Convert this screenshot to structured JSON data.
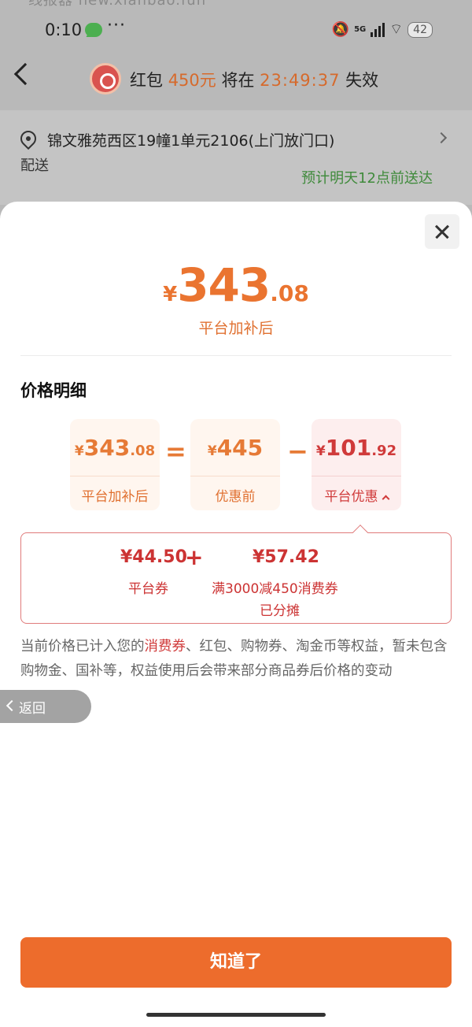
{
  "watermark": "线报器 new.xianbao.fun",
  "status_bar": {
    "time": "0:10",
    "network": "5G",
    "battery": "42",
    "more": "···"
  },
  "nav": {
    "title_prefix": "红包 ",
    "amount": "450元",
    "middle": " 将在 ",
    "countdown": "23:49:37",
    "suffix": " 失效"
  },
  "address": {
    "text": "锦文雅苑西区19幢1单元2106(上门放门口)",
    "delivery_label": "配送",
    "eta": "预计明天12点前送达"
  },
  "sheet": {
    "price": {
      "symbol": "¥",
      "integer": "343",
      "decimal": ".08",
      "label": "平台加补后"
    },
    "detail_title": "价格明细",
    "boxes": [
      {
        "symbol": "¥",
        "integer": "343",
        "decimal": ".08",
        "label": "平台加补后"
      },
      {
        "symbol": "¥",
        "integer": "445",
        "decimal": "",
        "label": "优惠前"
      },
      {
        "symbol": "¥",
        "integer": "101",
        "decimal": ".92",
        "label": "平台优惠"
      }
    ],
    "op_equals": "=",
    "op_minus": "−",
    "breakdown": {
      "item1_value": "¥44.50",
      "plus": "+",
      "item1_label": "平台券",
      "item2_value": "¥57.42",
      "item2_label": "满3000减450消费券",
      "item2_note": "已分摊"
    },
    "notice_pre": "当前价格已计入您的",
    "notice_highlight": "消费券",
    "notice_post": "、红包、购物券、淘金币等权益，暂未包含购物金、国补等，权益使用后会带来部分商品券后价格的变动",
    "float_back": "返回",
    "confirm_button": "知道了"
  },
  "colors": {
    "accent": "#ED6C2C",
    "discount_red": "#D03A3A",
    "eta_green": "#3F8A3B"
  }
}
